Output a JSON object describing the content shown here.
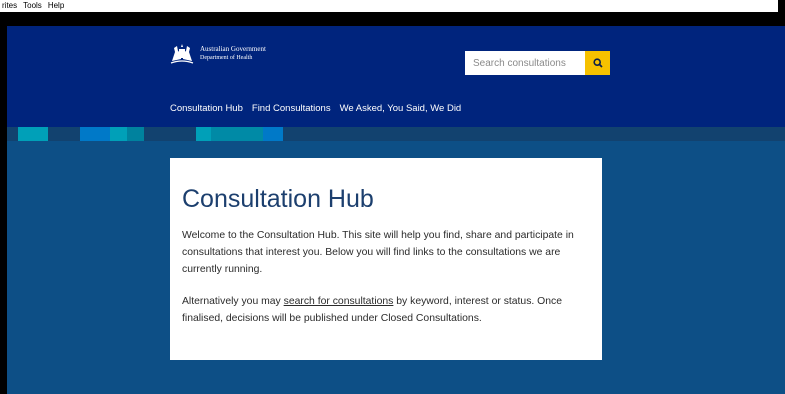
{
  "browser": {
    "menu": [
      "rites",
      "Tools",
      "Help"
    ]
  },
  "header": {
    "logo": {
      "line1": "Australian Government",
      "line2": "Department of Health"
    },
    "search": {
      "placeholder": "Search consultations"
    },
    "nav": [
      "Consultation Hub",
      "Find Consultations",
      "We Asked, You Said, We Did"
    ]
  },
  "colors": {
    "header_bg": "#00247d",
    "page_bg": "#0d4f86",
    "accent_yellow": "#f6c100",
    "stripe_teal": "#00a0b8",
    "stripe_blue": "#0079c8"
  },
  "main": {
    "title": "Consultation Hub",
    "intro": "Welcome to the Consultation Hub. This site will help you find, share and participate in consultations that interest you. Below you will find links to the consultations we are currently running.",
    "alt_prefix": "Alternatively you may ",
    "alt_link": "search for consultations",
    "alt_suffix": " by keyword, interest or status.  Once finalised, decisions will be published under Closed Consultations."
  }
}
